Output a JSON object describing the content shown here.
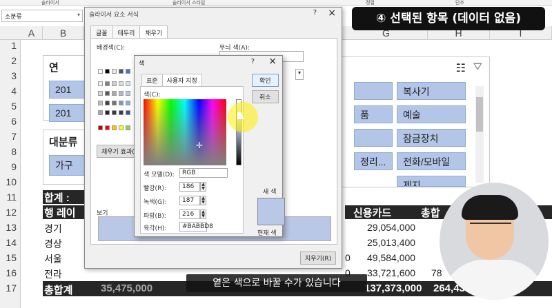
{
  "ribbon": {
    "labels": [
      "슬라이서",
      "슬라이서 스타일",
      "정렬",
      "단추"
    ]
  },
  "name_box": {
    "value": "소분류"
  },
  "columns": [
    "A",
    "B",
    "G",
    "H",
    "I"
  ],
  "rows": [
    "1",
    "2",
    "3",
    "4",
    "5",
    "6",
    "7",
    "8",
    "9",
    "10",
    "11",
    "12",
    "13",
    "14",
    "15",
    "16",
    "17"
  ],
  "slicer_year": {
    "title": "연",
    "items": [
      "201",
      "201"
    ]
  },
  "slicer_category": {
    "title": "대분류",
    "items": [
      "가구"
    ]
  },
  "slicer_sub": {
    "items_left": [
      "",
      "",
      "",
      "정리..."
    ],
    "items_right": [
      "복사기",
      "예술",
      "잠금장치",
      "전화/모바일",
      "제지"
    ],
    "partial_left": [
      "",
      "",
      "품",
      "정리..."
    ]
  },
  "pivot": {
    "summary_label": "합계 :",
    "row_label": "행 레이",
    "rows": [
      {
        "region": "경기",
        "value": "29,054,000"
      },
      {
        "region": "경상",
        "value": "25,013,400"
      },
      {
        "region": "서울",
        "value": "49,584,000"
      },
      {
        "region": "전라",
        "value": "33,721,600"
      }
    ],
    "total_label": "총합계",
    "total_left": "35,475,000",
    "total_value": "137,373,000",
    "total_right": "264,43",
    "col_card": "신용카드",
    "col_total": "총합",
    "partial_zero": "0",
    "partial_78": "78"
  },
  "format_dialog": {
    "title": "슬라이서 요소 서식",
    "help": "?",
    "close": "×",
    "tabs": [
      "글꼴",
      "테두리",
      "채우기"
    ],
    "active_tab": "채우기",
    "bg_color_label": "배경색(C):",
    "pattern_color_label": "무늬 색(A):",
    "fill_effects_btn": "채우기 효과(I)...",
    "sample_label": "보기",
    "clear_btn": "지우기(R)"
  },
  "color_dialog": {
    "title": "색",
    "help": "?",
    "close": "×",
    "tabs": [
      "표준",
      "사용자 지정"
    ],
    "active_tab": "사용자 지정",
    "colors_label": "색(C):",
    "model_label": "색 모델(D):",
    "model_value": "RGB",
    "red_label": "빨강(R):",
    "red_value": "186",
    "green_label": "녹색(G):",
    "green_value": "187",
    "blue_label": "파랑(B):",
    "blue_value": "216",
    "hex_label": "육각(H):",
    "hex_value": "#BABBD8",
    "ok_btn": "확인",
    "cancel_btn": "취소",
    "new_label": "새 색",
    "current_label": "현재 색",
    "preview_color": "#bac8e7"
  },
  "video_overlay": {
    "badge": "④ 선택된 항목 (데이터 없음)",
    "subtitle": "옅은 색으로 바꿀 수가 있습니다"
  },
  "colors": {
    "accent": "#b3c6e7",
    "dark": "#262626"
  }
}
